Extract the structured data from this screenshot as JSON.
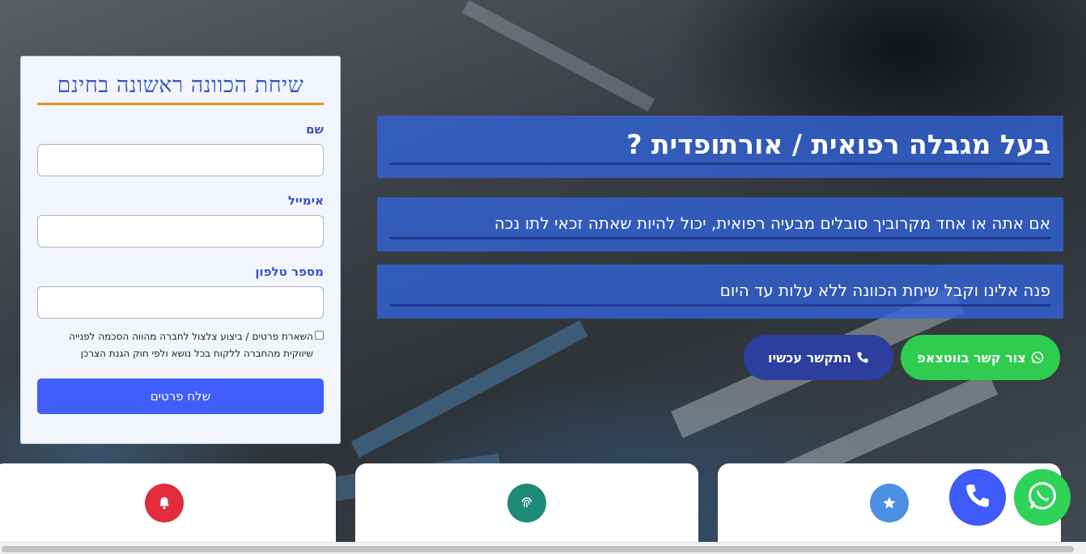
{
  "form": {
    "title": "שיחת הכוונה ראשונה בחינם",
    "name_label": "שם",
    "email_label": "אימייל",
    "phone_label": "מספר טלפון",
    "name_value": "",
    "email_value": "",
    "phone_value": "",
    "consent_line1": "השארת פרטים / ביצוע צלצול לחברה מהווה הסכמה לפנייה",
    "consent_line2": "שיווקית מהחברה ללקוח בכל נושא ולפי חוק הגנת הצרכן",
    "consent_checked": false,
    "submit_label": "שלח פרטים"
  },
  "hero": {
    "headline": "בעל מגבלה רפואית / אורתופדית ?",
    "line2": "אם אתה או אחד מקרוביך סובלים מבעיה רפואית, יכול להיות שאתה זכאי לתו נכה",
    "line3": "פנה אלינו וקבל שיחת הכוונה ללא עלות עד היום",
    "whatsapp_cta": "צור קשר בווטצאפ",
    "call_cta": "התקשר עכשיו"
  },
  "features": [
    {
      "icon": "star-icon",
      "color": "#4a90e2"
    },
    {
      "icon": "fingerprint-icon",
      "color": "#1f8a7a"
    },
    {
      "icon": "bell-icon",
      "color": "#e02c3c"
    }
  ],
  "floating": {
    "phone_icon": "phone-icon",
    "whatsapp_icon": "whatsapp-icon"
  },
  "colors": {
    "accent_blue": "#3f5efb",
    "title_blue": "#3a55c8",
    "underline_orange": "#e8902a",
    "whatsapp_green": "#2ecc4f",
    "call_navy": "#2d3f9e"
  }
}
